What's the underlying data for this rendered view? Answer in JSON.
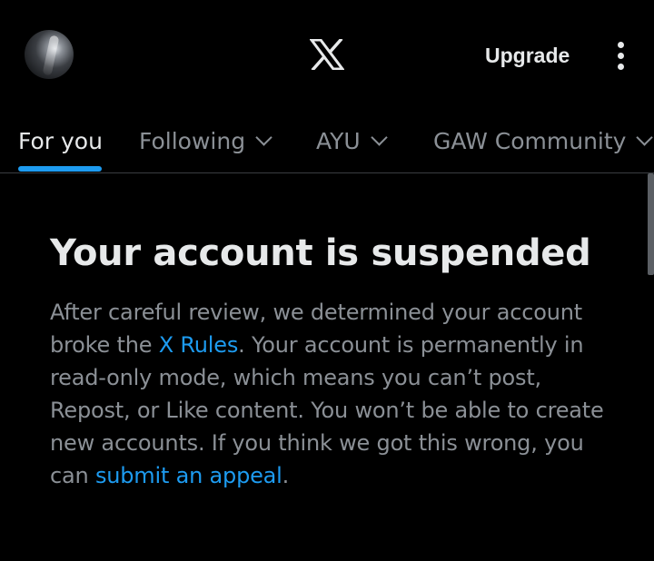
{
  "header": {
    "logo_icon": "x-logo-icon",
    "upgrade_label": "Upgrade",
    "more_icon": "more-vertical-icon"
  },
  "tabs": [
    {
      "label": "For you",
      "active": true
    },
    {
      "label": "Following",
      "dropdown": true
    },
    {
      "label": "AYU",
      "dropdown": true
    },
    {
      "label": "GAW Community",
      "dropdown": true
    }
  ],
  "notice": {
    "title": "Your account is suspended",
    "text_part1": "After careful review, we determined your account broke the ",
    "rules_link": "X Rules",
    "text_part2": ". Your account is permanently in read-only mode, which means you can’t post, Repost, or Like content. You won’t be able to create new accounts. If you think we got this wrong, you can ",
    "appeal_link": "submit an appeal",
    "text_part3": "."
  },
  "colors": {
    "background": "#000000",
    "accent": "#1d9bf0",
    "primary_text": "#e7e9ea",
    "secondary_text": "#8b9096"
  }
}
